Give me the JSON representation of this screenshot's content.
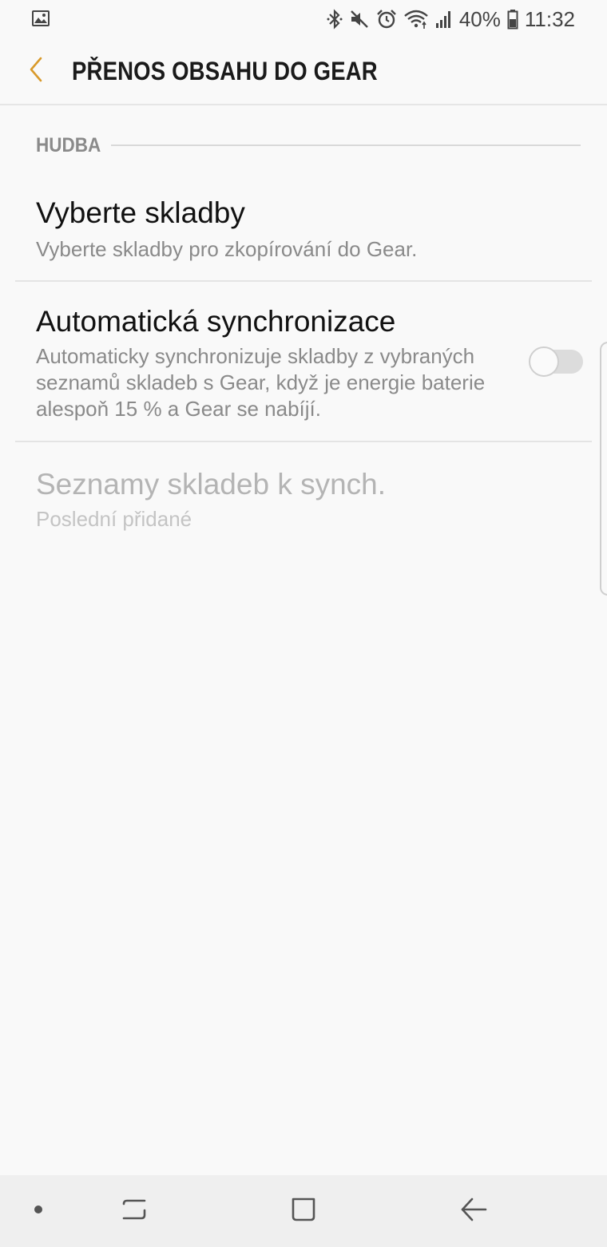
{
  "status_bar": {
    "battery_percent": "40%",
    "time": "11:32",
    "icons": [
      "gallery-notification-icon",
      "bluetooth-icon",
      "mute-icon",
      "alarm-icon",
      "wifi-icon",
      "signal-icon",
      "battery-icon"
    ]
  },
  "app_bar": {
    "title": "PŘENOS OBSAHU DO GEAR",
    "back_icon": "chevron-left-icon"
  },
  "colors": {
    "accent": "#d99a2b",
    "background": "#f9f9f9",
    "secondary_text": "#8a8a8a",
    "disabled_text": "#b4b4b4"
  },
  "section": {
    "title": "HUDBA"
  },
  "items": [
    {
      "title": "Vyberte skladby",
      "subtitle": "Vyberte skladby pro zkopírování do Gear."
    },
    {
      "title": "Automatická synchronizace",
      "subtitle": "Automaticky synchronizuje skladby z vybraných seznamů skladeb s Gear, když je energie baterie alespoň 15 % a Gear se nabíjí.",
      "toggle_on": false
    },
    {
      "title": "Seznamy skladeb k synch.",
      "subtitle": "Poslední přidané",
      "disabled": true
    }
  ],
  "nav_bar": {
    "icons": [
      "nav-dot-icon",
      "recent-apps-icon",
      "home-icon",
      "back-arrow-icon"
    ]
  }
}
